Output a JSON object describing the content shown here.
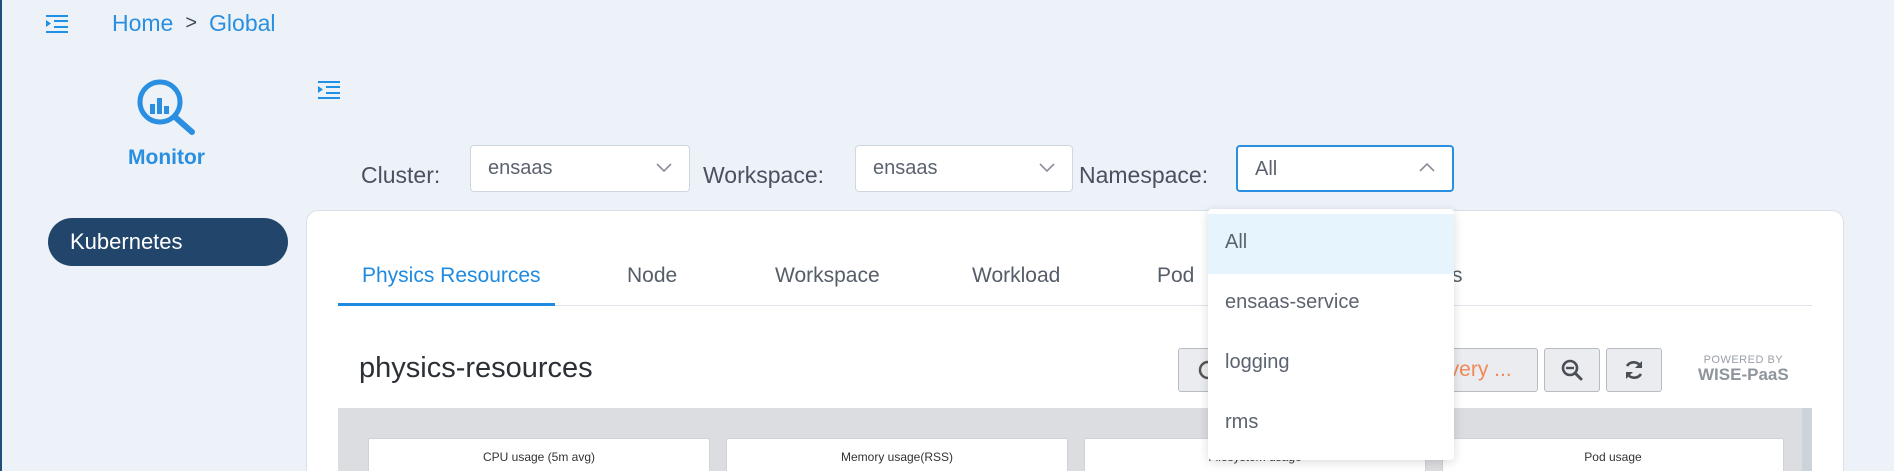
{
  "breadcrumb": {
    "home": "Home",
    "separator": ">",
    "current": "Global"
  },
  "sidebar": {
    "app_label": "Monitor",
    "items": [
      {
        "label": "Kubernetes",
        "active": true
      }
    ]
  },
  "filters": {
    "cluster": {
      "label": "Cluster:",
      "value": "ensaas"
    },
    "workspace": {
      "label": "Workspace:",
      "value": "ensaas"
    },
    "namespace": {
      "label": "Namespace:",
      "value": "All",
      "open": true
    }
  },
  "namespace_options": [
    "All",
    "ensaas-service",
    "logging",
    "rms"
  ],
  "tabs": [
    {
      "label": "Physics Resources",
      "active": true
    },
    {
      "label": "Node"
    },
    {
      "label": "Workspace"
    },
    {
      "label": "Workload"
    },
    {
      "label": "Pod"
    },
    {
      "label": "s"
    }
  ],
  "dashboard": {
    "title": "physics-resources",
    "refresh_label": "every ...",
    "powered_by": "POWERED BY",
    "brand": "WISE-PaaS",
    "panels": [
      "CPU usage (5m avg)",
      "Memory usage(RSS)",
      "Filesystem usage",
      "Pod usage"
    ]
  },
  "colors": {
    "accent": "#2a8fe0",
    "sidebar_active": "#22466b",
    "refresh_text": "#f08a5a"
  }
}
